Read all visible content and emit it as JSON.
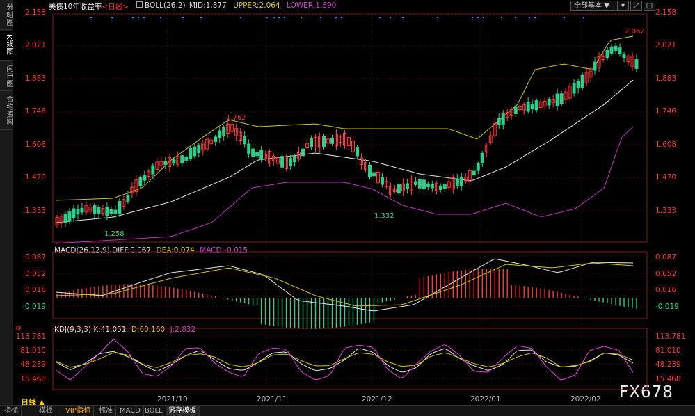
{
  "sidebar": {
    "tabs": [
      {
        "label": "分时图",
        "active": false
      },
      {
        "label": "K线图",
        "active": true
      },
      {
        "label": "闪电图",
        "active": false
      },
      {
        "label": "合约资料",
        "active": false
      }
    ]
  },
  "main": {
    "symbol": "美债10年收益率",
    "period_tag": "<日线>",
    "boll": {
      "label": "BOLL(26,2)",
      "mid": "MID:1.877",
      "upper": "UPPER:2.064",
      "lower": "LOWER:1.690"
    },
    "dropdown_value": "全部基本",
    "window_buttons": [
      "▾",
      "⤢",
      "□"
    ],
    "y_ticks": [
      "2.158",
      "2.021",
      "1.883",
      "1.746",
      "1.608",
      "1.470",
      "1.333"
    ],
    "annotations": {
      "high": "2.062",
      "peak_2021": "1.762",
      "low_left": "1.258",
      "low_dec": "1.332"
    }
  },
  "macd": {
    "label": "MACD(26,12,9)",
    "diff": "DIFF:0.067",
    "dea": "DEA:0.074",
    "macd": "MACD:-0.015",
    "y_ticks": [
      "0.087",
      "0.052",
      "0.016",
      "-0.019"
    ]
  },
  "kdj": {
    "label": "KDJ(9,3,3)",
    "k": "K:41.051",
    "d": "D:60.160",
    "j": "J:2.832",
    "y_ticks": [
      "113.781",
      "81.010",
      "48.239",
      "15.468"
    ]
  },
  "x_labels": [
    "2021/10",
    "2021/11",
    "2021/12",
    "2022/01",
    "2022/02"
  ],
  "bottom": {
    "period_label": "日线 ▲",
    "tabs": [
      "指标",
      "模板",
      "VIP指标",
      "标准",
      "MACD",
      "BOLL",
      "另存模板"
    ],
    "active_tab": 6
  },
  "watermark": "FX678",
  "colors": {
    "up": "#ff3b3b",
    "down": "#2ecf8c",
    "mid_line": "#e8e8e8",
    "upper_line": "#d4c800",
    "lower_line": "#c030c0",
    "y_right": "#ff3030",
    "macd_label": "#e0d000",
    "kdj_j": "#e040e0"
  }
}
